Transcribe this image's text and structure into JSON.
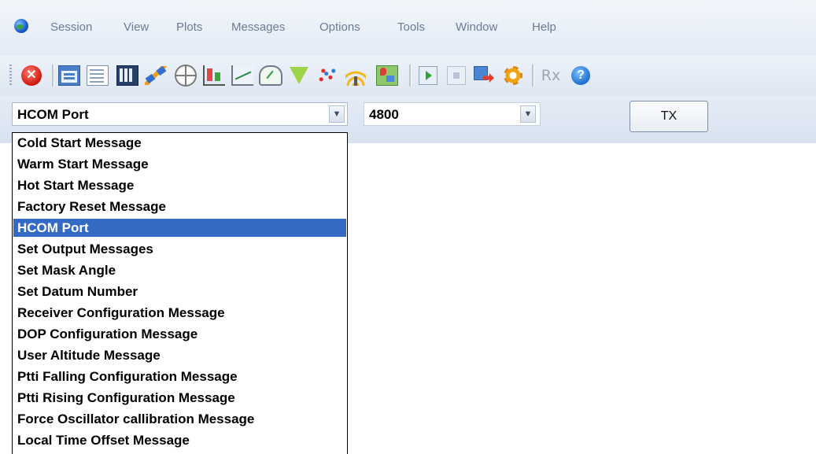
{
  "menubar": {
    "items": [
      "Session",
      "View",
      "Plots",
      "Messages",
      "Options",
      "Tools",
      "Window",
      "Help"
    ]
  },
  "toolbar": {
    "icons": [
      "close-icon",
      "session-window-icon",
      "list-view-icon",
      "data-grid-icon",
      "satellite-icon",
      "radar-icon",
      "bar-chart-icon",
      "line-plot-icon",
      "gauge-icon",
      "filter-icon",
      "scatter-plot-icon",
      "signal-icon",
      "map-icon",
      "play-icon",
      "stop-icon",
      "export-icon",
      "settings-gear-icon",
      "rx-icon",
      "help-icon"
    ],
    "rx_label": "Rx",
    "close_glyph": "✕",
    "help_glyph": "?"
  },
  "command": {
    "message_select": "HCOM Port",
    "baud_select": "4800",
    "tx_label": "TX"
  },
  "dropdown": {
    "selected_index": 4,
    "options": [
      "Cold Start Message",
      "Warm Start Message",
      "Hot Start Message",
      "Factory Reset Message",
      "HCOM Port",
      "Set Output Messages",
      "Set Mask Angle",
      "Set Datum Number",
      "Receiver Configuration Message",
      "DOP Configuration Message",
      "User Altitude Message",
      "Ptti Falling Configuration Message",
      "Ptti Rising Configuration Message",
      "Force Oscillator callibration Message",
      "Local Time Offset Message"
    ]
  },
  "colors": {
    "selection": "#3469c4",
    "menu_text": "#6b7c93"
  }
}
